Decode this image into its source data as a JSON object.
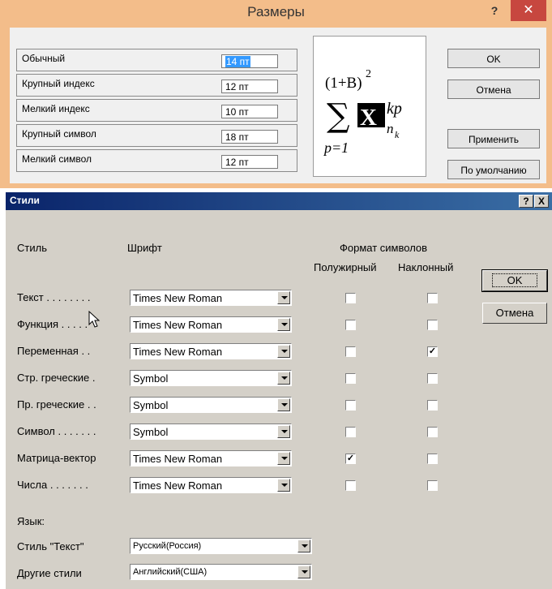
{
  "sizes": {
    "title": "Размеры",
    "help": "?",
    "close": "✕",
    "rows": [
      {
        "label": "Обычный",
        "value": "14 пт"
      },
      {
        "label": "Крупный индекс",
        "value": "12 пт"
      },
      {
        "label": "Мелкий индекс",
        "value": "10 пт"
      },
      {
        "label": "Крупный символ",
        "value": "18 пт"
      },
      {
        "label": "Мелкий символ",
        "value": "12 пт"
      }
    ],
    "buttons": {
      "ok": "OK",
      "cancel": "Отмена",
      "apply": "Применить",
      "default": "По умолчанию"
    },
    "preview": {
      "paren": "(1+B)",
      "exp": "2",
      "sigma": "∑",
      "x": "X",
      "sup": "kp",
      "sub_n": "n",
      "sub_k": "k",
      "lower": "p=1"
    }
  },
  "styles": {
    "title": "Стили",
    "help": "?",
    "close": "X",
    "headers": {
      "style": "Стиль",
      "font": "Шрифт",
      "format": "Формат символов",
      "bold": "Полужирный",
      "italic": "Наклонный"
    },
    "rows": [
      {
        "label": "Текст . . . . . . . .",
        "font": "Times New Roman",
        "bold": false,
        "italic": false
      },
      {
        "label": "Функция . . . . .",
        "font": "Times New Roman",
        "bold": false,
        "italic": false
      },
      {
        "label": "Переменная . .",
        "font": "Times New Roman",
        "bold": false,
        "italic": true
      },
      {
        "label": "Стр. греческие .",
        "font": "Symbol",
        "bold": false,
        "italic": false
      },
      {
        "label": "Пр. греческие . .",
        "font": "Symbol",
        "bold": false,
        "italic": false
      },
      {
        "label": "Символ . . . . . . .",
        "font": "Symbol",
        "bold": false,
        "italic": false
      },
      {
        "label": "Матрица-вектор",
        "font": "Times New Roman",
        "bold": true,
        "italic": false
      },
      {
        "label": "Числа . . . . . . .",
        "font": "Times New Roman",
        "bold": false,
        "italic": false
      }
    ],
    "language": {
      "label": "Язык:",
      "text_style_label": "Стиль \"Текст\"",
      "text_style_value": "Русский(Россия)",
      "other_label": "Другие стили",
      "other_value": "Английский(США)"
    },
    "buttons": {
      "ok": "OK",
      "cancel": "Отмена"
    }
  }
}
